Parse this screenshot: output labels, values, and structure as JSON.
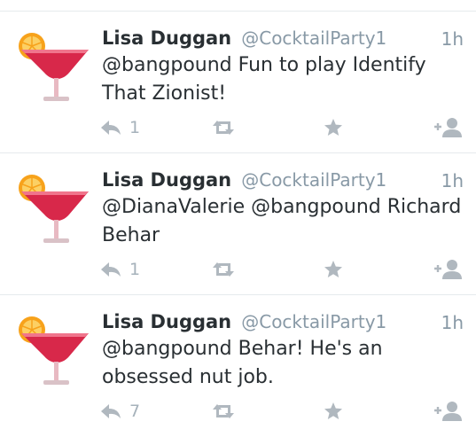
{
  "colors": {
    "name": "#292f33",
    "meta": "#8899a6",
    "action_icon": "#b0b8bf",
    "divider": "#e6eaed"
  },
  "icons": {
    "avatar": "cocktail-glass-with-orange",
    "reply": "reply-arrow-icon",
    "retweet": "retweet-icon",
    "favorite": "star-icon",
    "follow": "add-user-icon"
  },
  "tweets": [
    {
      "name": "Lisa Duggan",
      "handle": "@CocktailParty1",
      "time": "1h",
      "text": "@bangpound Fun to play Identify That Zionist!",
      "reply_count": "1"
    },
    {
      "name": "Lisa Duggan",
      "handle": "@CocktailParty1",
      "time": "1h",
      "text": "@DianaValerie @bangpound Richard Behar",
      "reply_count": "1"
    },
    {
      "name": "Lisa Duggan",
      "handle": "@CocktailParty1",
      "time": "1h",
      "text": "@bangpound Behar! He's an obsessed nut job.",
      "reply_count": "7"
    }
  ]
}
